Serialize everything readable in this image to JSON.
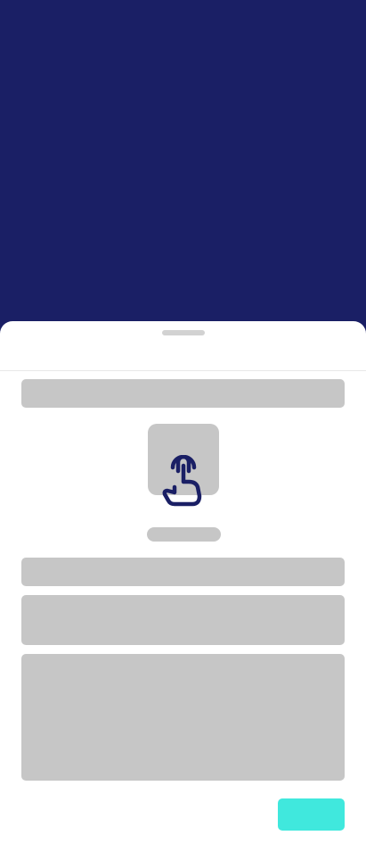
{
  "colors": {
    "backdrop": "#1a1f65",
    "sheet": "#ffffff",
    "skeleton": "#c6c6c6",
    "handle": "#d2d2d2",
    "accent": "#40e8dd",
    "icon": "#1a1f65"
  },
  "sheet": {
    "icon": "tap-hand-icon",
    "action_button_label": ""
  }
}
